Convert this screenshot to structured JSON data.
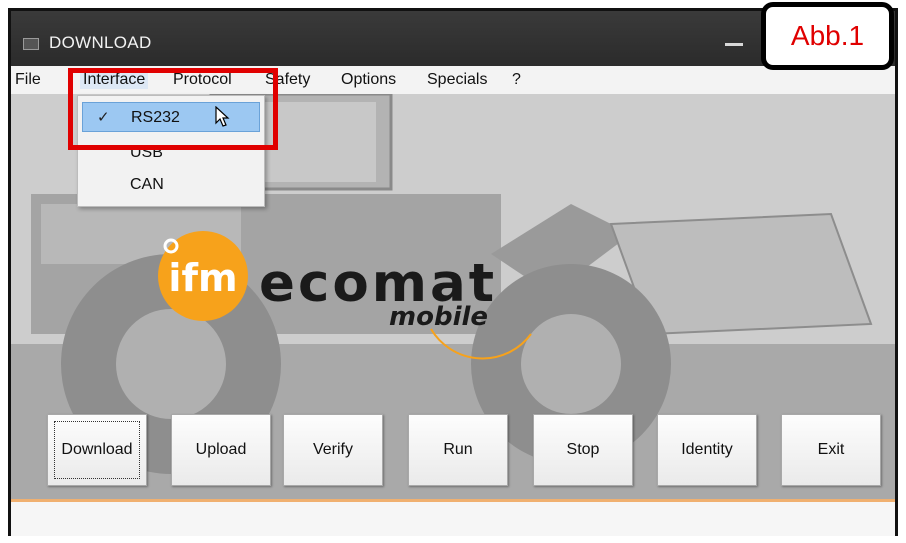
{
  "window": {
    "title": "DOWNLOAD",
    "badge": "Abb.1"
  },
  "menu": {
    "items": [
      "File",
      "Interface",
      "Protocol",
      "Safety",
      "Options",
      "Specials",
      "?"
    ],
    "active": "Interface"
  },
  "interface_menu": {
    "items": [
      {
        "label": "RS232",
        "checked": true,
        "selected": true
      },
      {
        "label": "USB",
        "checked": false,
        "selected": false
      },
      {
        "label": "CAN",
        "checked": false,
        "selected": false
      }
    ],
    "check_icon": "checkmark-icon"
  },
  "logo": {
    "ecomat": "ecomat",
    "mobile": "mobile",
    "brand_orange": "#f7a21b",
    "brand_text": "ifm"
  },
  "buttons": [
    "Download",
    "Upload",
    "Verify",
    "Run",
    "Stop",
    "Identity",
    "Exit"
  ],
  "colors": {
    "highlight_red": "#e00000",
    "menu_selected": "#9cc8f2"
  }
}
